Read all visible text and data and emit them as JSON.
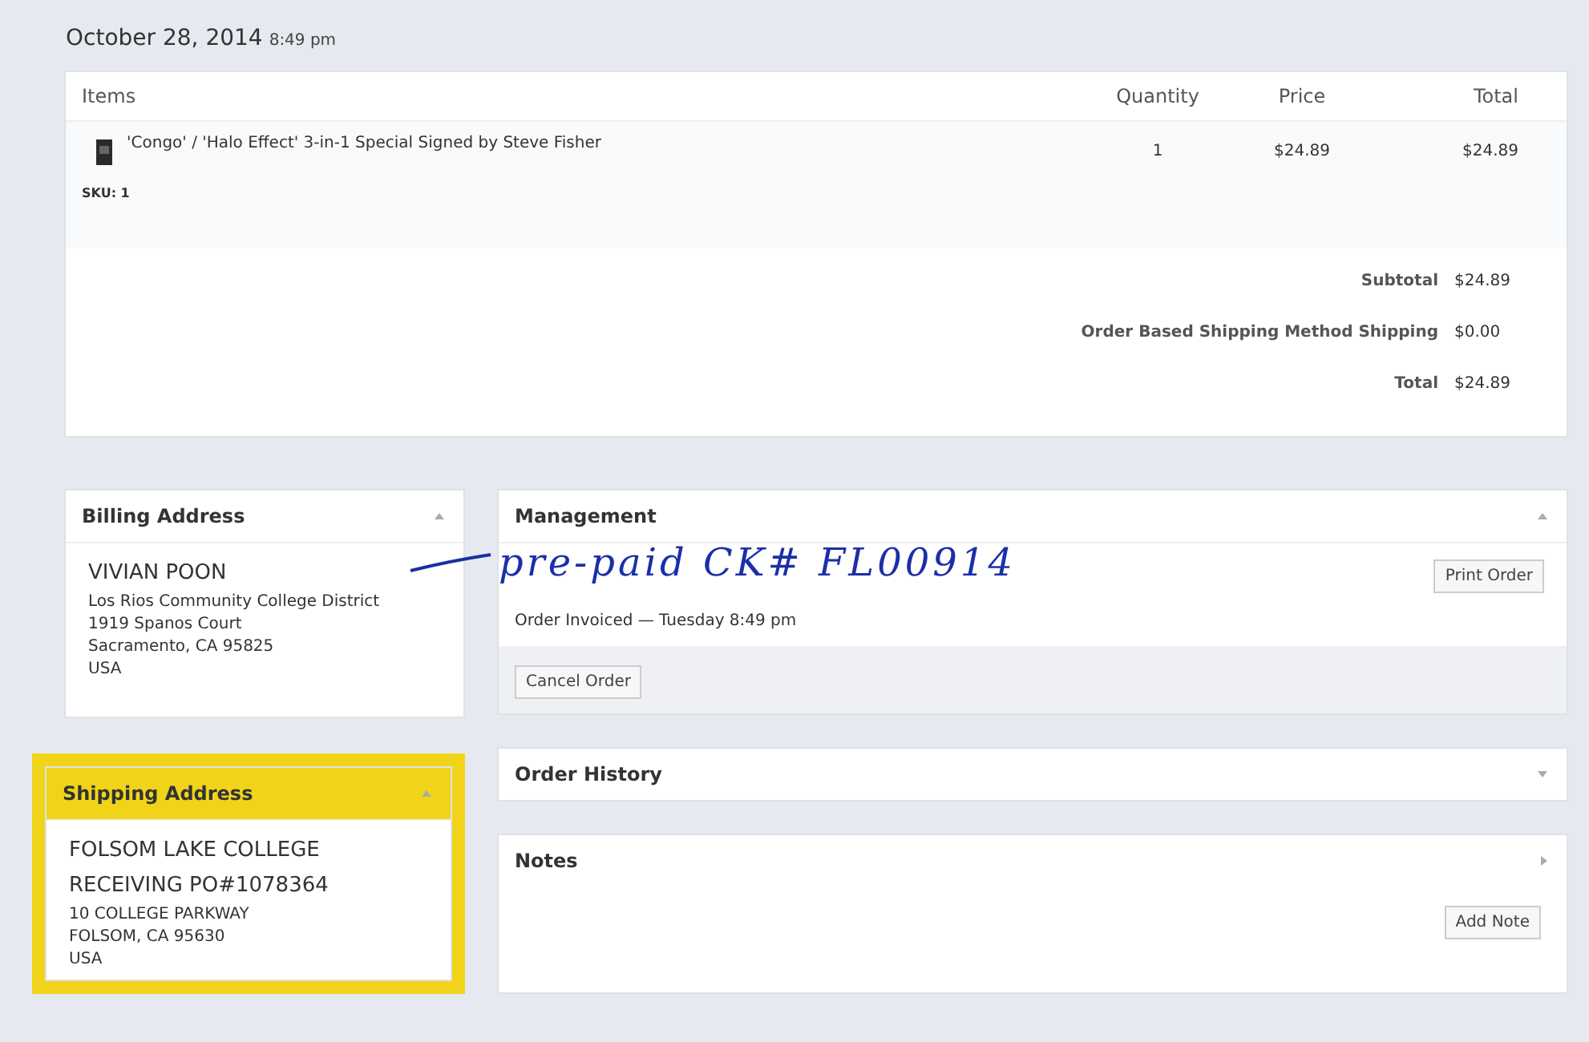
{
  "header": {
    "date": "October 28, 2014",
    "time": "8:49 pm"
  },
  "items": {
    "columns": [
      "Items",
      "Quantity",
      "Price",
      "Total"
    ],
    "rows": [
      {
        "name": "'Congo' / 'Halo Effect' 3-in-1 Special Signed by Steve Fisher",
        "quantity": "1",
        "price": "$24.89",
        "total": "$24.89",
        "sku": "SKU: 1"
      }
    ],
    "totals": [
      {
        "label": "Subtotal",
        "value": "$24.89"
      },
      {
        "label": "Order Based Shipping Method Shipping",
        "value": "$0.00"
      },
      {
        "label": "Total",
        "value": "$24.89"
      }
    ]
  },
  "billing": {
    "title": "Billing Address",
    "lines": [
      {
        "text": "VIVIAN POON",
        "kind": "large"
      },
      {
        "text": "Los Rios Community College District",
        "kind": "small"
      },
      {
        "text": "1919 Spanos Court",
        "kind": "small"
      },
      {
        "text": "Sacramento, CA 95825",
        "kind": "small"
      },
      {
        "text": "USA",
        "kind": "small"
      }
    ]
  },
  "shipping": {
    "title": "Shipping Address",
    "highlighted": true,
    "lines": [
      {
        "text": "FOLSOM LAKE COLLEGE",
        "kind": "large"
      },
      {
        "text": "RECEIVING PO#1078364",
        "kind": "large"
      },
      {
        "text": "10 COLLEGE PARKWAY",
        "kind": "small"
      },
      {
        "text": "FOLSOM, CA 95630",
        "kind": "small"
      },
      {
        "text": "USA",
        "kind": "small"
      }
    ]
  },
  "management": {
    "title": "Management",
    "status": "Order Invoiced — Tuesday  8:49 pm",
    "print_button": "Print Order",
    "cancel_button": "Cancel Order"
  },
  "order_history": {
    "title": "Order History"
  },
  "notes": {
    "title": "Notes",
    "button": "Add Note"
  },
  "annotation": {
    "text": "pre-paid CK# FL00914"
  }
}
